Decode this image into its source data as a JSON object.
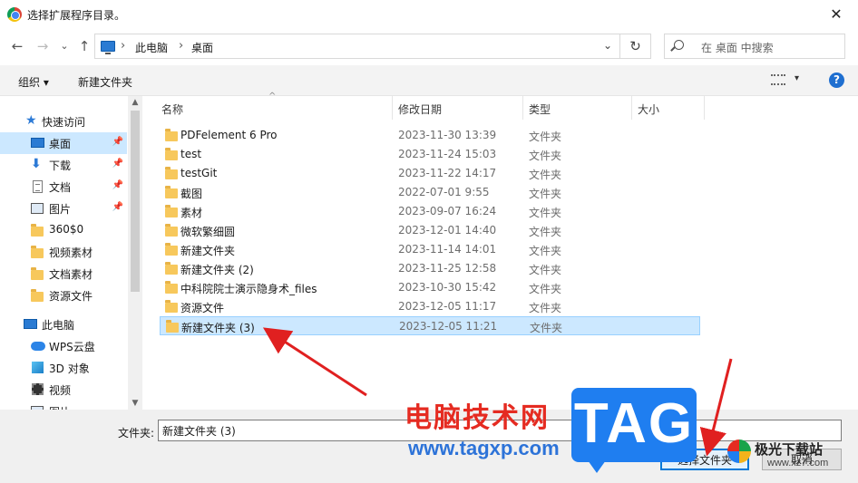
{
  "window": {
    "title": "选择扩展程序目录。",
    "close": "✕"
  },
  "nav": {
    "back": "←",
    "forward": "→",
    "recent": "⌄",
    "up": "↑",
    "path": [
      "此电脑",
      "桌面"
    ],
    "path_sep": "›",
    "dropdown": "⌄",
    "refresh": "↻",
    "search_placeholder": "在 桌面 中搜索"
  },
  "toolbar": {
    "organize": "组织 ▾",
    "new_folder": "新建文件夹",
    "help": "?",
    "view_caret": "▾"
  },
  "sidebar": {
    "items": [
      {
        "label": "快速访问",
        "icon": "star-icon",
        "pinned": false,
        "selected": false
      },
      {
        "label": "桌面",
        "icon": "desktop-icon",
        "pinned": true,
        "selected": true
      },
      {
        "label": "下载",
        "icon": "download-icon",
        "pinned": true,
        "selected": false
      },
      {
        "label": "文档",
        "icon": "document-icon",
        "pinned": true,
        "selected": false
      },
      {
        "label": "图片",
        "icon": "pictures-icon",
        "pinned": true,
        "selected": false
      },
      {
        "label": "360$0",
        "icon": "folder-icon",
        "pinned": false,
        "selected": false
      },
      {
        "label": "视频素材",
        "icon": "folder-icon",
        "pinned": false,
        "selected": false
      },
      {
        "label": "文档素材",
        "icon": "folder-icon",
        "pinned": false,
        "selected": false
      },
      {
        "label": "资源文件",
        "icon": "folder-icon",
        "pinned": false,
        "selected": false
      },
      {
        "label": "此电脑",
        "icon": "computer-icon",
        "pinned": false,
        "selected": false
      },
      {
        "label": "WPS云盘",
        "icon": "cloud-icon",
        "pinned": false,
        "selected": false
      },
      {
        "label": "3D 对象",
        "icon": "cube-icon",
        "pinned": false,
        "selected": false
      },
      {
        "label": "视频",
        "icon": "video-icon",
        "pinned": false,
        "selected": false
      },
      {
        "label": "图片",
        "icon": "pictures-icon",
        "pinned": false,
        "selected": false
      }
    ],
    "pin_glyph": "📌"
  },
  "columns": {
    "name": "名称",
    "date": "修改日期",
    "type": "类型",
    "size": "大小",
    "sort_glyph": "^"
  },
  "files": [
    {
      "name": "PDFelement 6 Pro",
      "date": "2023-11-30 13:39",
      "type": "文件夹",
      "selected": false
    },
    {
      "name": "test",
      "date": "2023-11-24 15:03",
      "type": "文件夹",
      "selected": false
    },
    {
      "name": "testGit",
      "date": "2023-11-22 14:17",
      "type": "文件夹",
      "selected": false
    },
    {
      "name": "截图",
      "date": "2022-07-01 9:55",
      "type": "文件夹",
      "selected": false
    },
    {
      "name": "素材",
      "date": "2023-09-07 16:24",
      "type": "文件夹",
      "selected": false
    },
    {
      "name": "微软繁细圆",
      "date": "2023-12-01 14:40",
      "type": "文件夹",
      "selected": false
    },
    {
      "name": "新建文件夹",
      "date": "2023-11-14 14:01",
      "type": "文件夹",
      "selected": false
    },
    {
      "name": "新建文件夹 (2)",
      "date": "2023-11-25 12:58",
      "type": "文件夹",
      "selected": false
    },
    {
      "name": "中科院院士演示隐身术_files",
      "date": "2023-10-30 15:42",
      "type": "文件夹",
      "selected": false
    },
    {
      "name": "资源文件",
      "date": "2023-12-05 11:17",
      "type": "文件夹",
      "selected": false
    },
    {
      "name": "新建文件夹 (3)",
      "date": "2023-12-05 11:21",
      "type": "文件夹",
      "selected": true
    }
  ],
  "footer": {
    "folder_label": "文件夹:",
    "folder_value": "新建文件夹 (3)",
    "select_button": "选择文件夹",
    "cancel_button": "取消"
  },
  "watermark": {
    "cn_text": "电脑技术网",
    "url": "www.tagxp.com",
    "tag": "TAG",
    "logo_cn": "极光下载站",
    "logo_url": "www.xz7.com"
  },
  "colors": {
    "selection": "#cce8ff",
    "accent": "#0078d7",
    "arrow": "#e02020",
    "folder": "#f7c85c"
  }
}
